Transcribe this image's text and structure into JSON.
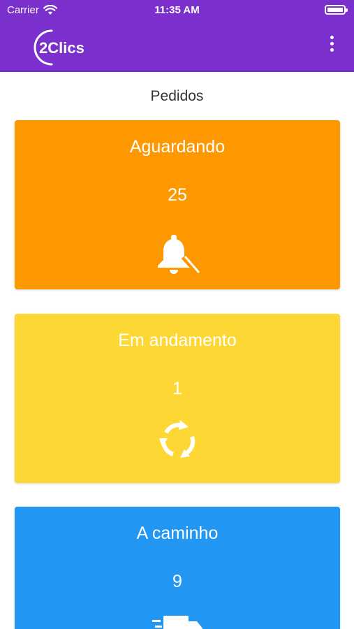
{
  "status_bar": {
    "carrier": "Carrier",
    "time": "11:35 AM"
  },
  "app_bar": {
    "logo_text": "2Clics",
    "background_color": "#7b2fcc"
  },
  "page": {
    "title": "Pedidos"
  },
  "cards": [
    {
      "label": "Aguardando",
      "count": "25",
      "icon": "bell-icon",
      "color": "#fe9800"
    },
    {
      "label": "Em andamento",
      "count": "1",
      "icon": "refresh-cycle-icon",
      "color": "#fdd835"
    },
    {
      "label": "A caminho",
      "count": "9",
      "icon": "delivery-truck-icon",
      "color": "#2196f3"
    }
  ]
}
